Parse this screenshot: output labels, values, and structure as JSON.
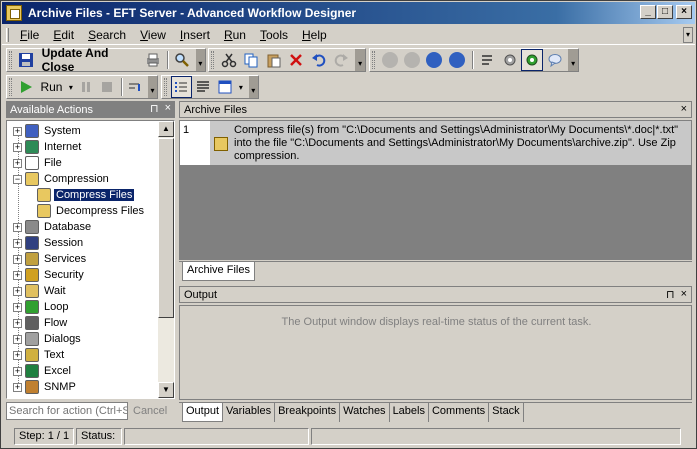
{
  "window": {
    "title": "Archive Files - EFT Server - Advanced Workflow Designer",
    "min_label": "_",
    "max_label": "□",
    "close_label": "×"
  },
  "menu": [
    "File",
    "Edit",
    "Search",
    "View",
    "Insert",
    "Run",
    "Tools",
    "Help"
  ],
  "toolbar": {
    "update_close_label": "Update And Close",
    "run_label": "Run"
  },
  "left_panel": {
    "title": "Available Actions",
    "pin": "⊓",
    "close": "×",
    "tree": [
      {
        "label": "System",
        "expander": "+",
        "icon": "system-icon",
        "color": "#4060c0"
      },
      {
        "label": "Internet",
        "expander": "+",
        "icon": "globe-icon",
        "color": "#2e8b57"
      },
      {
        "label": "File",
        "expander": "+",
        "icon": "file-icon",
        "color": "#ffffff"
      },
      {
        "label": "Compression",
        "expander": "−",
        "icon": "folder-icon",
        "color": "#e8c860"
      },
      {
        "label": "Compress Files",
        "expander": "",
        "icon": "compress-icon",
        "color": "#e8c860",
        "child": true,
        "selected": true
      },
      {
        "label": "Decompress Files",
        "expander": "",
        "icon": "decompress-icon",
        "color": "#e8c860",
        "child": true
      },
      {
        "label": "Database",
        "expander": "+",
        "icon": "database-icon",
        "color": "#8a8a8a"
      },
      {
        "label": "Session",
        "expander": "+",
        "icon": "session-icon",
        "color": "#304080"
      },
      {
        "label": "Services",
        "expander": "+",
        "icon": "services-icon",
        "color": "#c0a040"
      },
      {
        "label": "Security",
        "expander": "+",
        "icon": "security-icon",
        "color": "#d0a020"
      },
      {
        "label": "Wait",
        "expander": "+",
        "icon": "clock-icon",
        "color": "#e0c060"
      },
      {
        "label": "Loop",
        "expander": "+",
        "icon": "loop-icon",
        "color": "#30a030"
      },
      {
        "label": "Flow",
        "expander": "+",
        "icon": "flow-icon",
        "color": "#606060"
      },
      {
        "label": "Dialogs",
        "expander": "+",
        "icon": "dialogs-icon",
        "color": "#a0a0a0"
      },
      {
        "label": "Text",
        "expander": "+",
        "icon": "text-icon",
        "color": "#d0b040"
      },
      {
        "label": "Excel",
        "expander": "+",
        "icon": "excel-icon",
        "color": "#208040"
      },
      {
        "label": "SNMP",
        "expander": "+",
        "icon": "snmp-icon",
        "color": "#c08030"
      }
    ],
    "search_placeholder": "Search for action (Ctrl+S)",
    "cancel_label": "Cancel"
  },
  "doc_panel": {
    "title": "Archive Files",
    "close": "×",
    "row_number": "1",
    "step_text_1": "Compress file(s) from \"C:\\Documents and Settings\\Administrator\\My Documents\\*.doc|*.txt\"",
    "step_text_2": "into the file \"C:\\Documents and Settings\\Administrator\\My Documents\\archive.zip\".  Use Zip",
    "step_text_3": "compression.",
    "tab": "Archive Files"
  },
  "output_panel": {
    "title": "Output",
    "pin": "⊓",
    "close": "×",
    "message": "The Output window displays real-time status of the current task.",
    "tabs": [
      "Output",
      "Variables",
      "Breakpoints",
      "Watches",
      "Labels",
      "Comments",
      "Stack"
    ]
  },
  "status": {
    "step": "Step: 1 / 1",
    "status_label": "Status:"
  }
}
